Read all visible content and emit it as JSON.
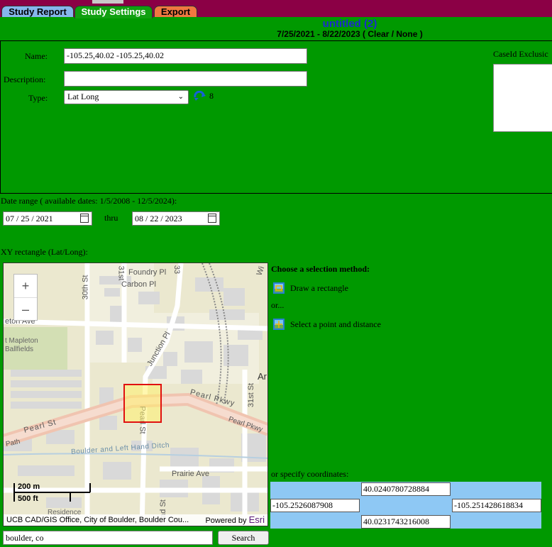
{
  "tabs": [
    {
      "label": "Study Report"
    },
    {
      "label": "Study Settings"
    },
    {
      "label": "Export"
    }
  ],
  "study": {
    "title": "untitled (2)",
    "subtitle": "7/25/2021 - 8/22/2023 ( Clear / None )"
  },
  "form": {
    "name_label": "Name:",
    "name_value": "-105.25,40.02 -105.25,40.02",
    "description_label": "Description:",
    "description_value": "",
    "type_label": "Type:",
    "type_value": "Lat Long",
    "type_count": "8",
    "caseid_label": "CaseId Exclusic"
  },
  "dates": {
    "range_label": "Date range ( available dates: 1/5/2008 - 12/5/2024):",
    "start": "07 / 25 / 2021",
    "thru_label": "thru",
    "end": "08 / 22 / 2023"
  },
  "xy": {
    "label": "XY rectangle (Lat/Long):"
  },
  "map": {
    "zoom_in": "+",
    "zoom_out": "–",
    "scale_metric": "200 m",
    "scale_imperial": "500 ft",
    "attribution": "UCB CAD/GIS Office, City of Boulder, Boulder Cou...",
    "powered_by": "Powered by",
    "esri": "Esri",
    "labels": {
      "foundry": "Foundry Pl",
      "carbon": "Carbon Pl",
      "st30": "30th St",
      "st31_top": "31st",
      "st33": "33",
      "mapleton_ave": "eton Ave",
      "mapleton_park": "t Mapleton",
      "ballfields": "Ballfields",
      "junction": "Junction Pl",
      "pearl_pkwy": "Pearl Pkwy",
      "pearl_pkwy2": "Pearl Pkwy",
      "pearl_st": "Pearl St",
      "pearl_st_v": "Pearl St",
      "st31": "31st St",
      "path": "Path",
      "ditch": "Boulder and Left Hand Ditch",
      "prairie": "Prairie Ave",
      "residence": "Residence",
      "ad_st": "ad St",
      "ar": "Ar",
      "wi": "Wi"
    }
  },
  "search": {
    "value": "boulder, co",
    "button": "Search"
  },
  "selection": {
    "heading": "Choose a selection method:",
    "draw_label": "Draw a rectangle",
    "or_label": "or...",
    "point_label": "Select a point and distance",
    "coords_label": "or specify coordinates:"
  },
  "coords": {
    "north": "40.0240780728884",
    "west": "-105.2526087908",
    "east": "-105.251428618834",
    "south": "40.0231743216008"
  }
}
